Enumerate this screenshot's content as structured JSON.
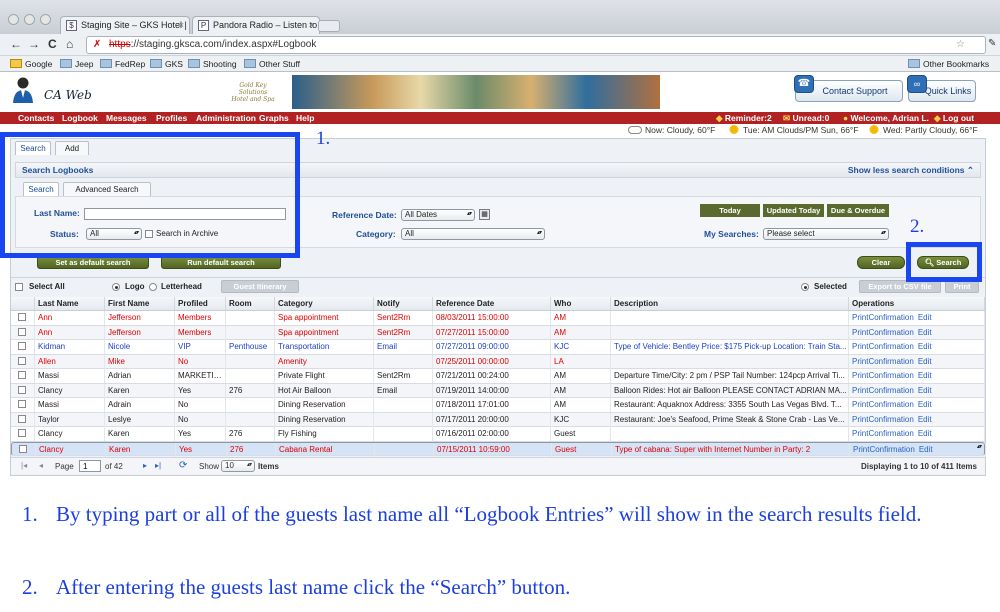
{
  "browser": {
    "tabs": [
      {
        "label": "Staging Site – GKS Hotel | Lo",
        "favicon": "GKS"
      },
      {
        "label": "Pandora Radio – Listen to Fr",
        "favicon": "P"
      }
    ],
    "url_proto": "https",
    "url_rest": "://staging.gksca.com/index.aspx#Logbook",
    "bookmarks": [
      "Google",
      "Jeep",
      "FedRep",
      "GKS",
      "Shooting",
      "Other Stuff"
    ],
    "other_bookmarks": "Other Bookmarks"
  },
  "app": {
    "logo_text": "CA Web",
    "hotel_logo": "Gold Key Solutions Hotel and Spa",
    "contact_support": "Contact Support",
    "quick_links": "Quick Links"
  },
  "menu": {
    "items": [
      "Contacts",
      "Logbook",
      "Messages",
      "Profiles",
      "Administration",
      "Graphs",
      "Help"
    ],
    "reminder": "Reminder:2",
    "unread": "Unread:0",
    "welcome": "Welcome, Adrian L.",
    "logout": "Log out"
  },
  "weather": {
    "now": "Now: Cloudy, 60°F",
    "tue": "Tue: AM Clouds/PM Sun, 66°F",
    "wed": "Wed: Partly Cloudy, 66°F"
  },
  "page_tabs": [
    "Search",
    "Add"
  ],
  "search": {
    "section_title": "Search Logbooks",
    "toggle_conditions": "Show less search conditions",
    "subtabs": [
      "Search",
      "Advanced Search"
    ],
    "last_name_label": "Last Name:",
    "last_name_value": "",
    "status_label": "Status:",
    "status_value": "All",
    "archive_label": "Search in Archive",
    "refdate_label": "Reference Date:",
    "refdate_value": "All Dates",
    "category_label": "Category:",
    "category_value": "All",
    "quick_buttons": [
      "Today",
      "Updated Today",
      "Due & Overdue"
    ],
    "my_searches_label": "My Searches:",
    "my_searches_value": "Please select",
    "set_default": "Set as default search",
    "run_default": "Run default search",
    "clear": "Clear",
    "search_button": "Search"
  },
  "grid_toolbar": {
    "select_all": "Select All",
    "logo": "Logo",
    "letterhead": "Letterhead",
    "guest_itinerary": "Guest Itinerary",
    "selected": "Selected",
    "export_csv": "Export to CSV file",
    "print": "Print"
  },
  "columns": [
    "Last Name",
    "First Name",
    "Profiled",
    "Room",
    "Category",
    "Notify",
    "Reference Date",
    "Who",
    "Description",
    "Operations"
  ],
  "rows": [
    {
      "last": "Ann",
      "first": "Jefferson",
      "profiled": "Members",
      "room": "",
      "category": "Spa appointment",
      "notify": "Sent2Rm",
      "date": "08/03/2011 15:00:00",
      "who": "AM",
      "desc": "",
      "color": "red"
    },
    {
      "last": "Ann",
      "first": "Jefferson",
      "profiled": "Members",
      "room": "",
      "category": "Spa appointment",
      "notify": "Sent2Rm",
      "date": "07/27/2011 15:00:00",
      "who": "AM",
      "desc": "",
      "color": "red"
    },
    {
      "last": "Kidman",
      "first": "Nicole",
      "profiled": "VIP",
      "room": "Penthouse",
      "category": "Transportation",
      "notify": "Email",
      "date": "07/27/2011 09:00:00",
      "who": "KJC",
      "desc": "Type of Vehicle: Bentley Price: $175 Pick-up Location: Train Sta...",
      "color": "blue"
    },
    {
      "last": "Allen",
      "first": "Mike",
      "profiled": "No",
      "room": "",
      "category": "Amenity",
      "notify": "",
      "date": "07/25/2011 00:00:00",
      "who": "LA",
      "desc": "",
      "color": "red"
    },
    {
      "last": "Massi",
      "first": "Adrian",
      "profiled": "MARKETING",
      "room": "",
      "category": "Private Flight",
      "notify": "Sent2Rm",
      "date": "07/21/2011 00:24:00",
      "who": "AM",
      "desc": "Departure Time/City: 2 pm / PSP Tail Number: 124pcp Arrival Ti...",
      "color": ""
    },
    {
      "last": "Clancy",
      "first": "Karen",
      "profiled": "Yes",
      "room": "276",
      "category": "Hot Air Balloon",
      "notify": "Email",
      "date": "07/19/2011 14:00:00",
      "who": "AM",
      "desc": "Balloon Rides: Hot air Balloon PLEASE CONTACT ADRIAN MA...",
      "color": ""
    },
    {
      "last": "Massi",
      "first": "Adrain",
      "profiled": "No",
      "room": "",
      "category": "Dining Reservation",
      "notify": "",
      "date": "07/18/2011 17:01:00",
      "who": "AM",
      "desc": "Restaurant: Aquaknox Address: 3355 South Las Vegas Blvd. T...",
      "color": ""
    },
    {
      "last": "Taylor",
      "first": "Leslye",
      "profiled": "No",
      "room": "",
      "category": "Dining Reservation",
      "notify": "",
      "date": "07/17/2011 20:00:00",
      "who": "KJC",
      "desc": "Restaurant: Joe's Seafood, Prime Steak & Stone Crab - Las Ve...",
      "color": ""
    },
    {
      "last": "Clancy",
      "first": "Karen",
      "profiled": "Yes",
      "room": "276",
      "category": "Fly Fishing",
      "notify": "",
      "date": "07/16/2011 02:00:00",
      "who": "Guest",
      "desc": "",
      "color": ""
    },
    {
      "last": "Clancy",
      "first": "Karen",
      "profiled": "Yes",
      "room": "276",
      "category": "Cabana Rental",
      "notify": "",
      "date": "07/15/2011 10:59:00",
      "who": "Guest",
      "desc": "Type of cabana: Super with Internet Number in Party: 2",
      "color": "red"
    }
  ],
  "operations": {
    "print": "PrintConfirmation",
    "edit": "Edit"
  },
  "pager": {
    "page_label": "Page",
    "page_value": "1",
    "of_pages": "of 42",
    "show_label": "Show",
    "show_value": "10",
    "items_label": "Items",
    "displaying": "Displaying 1 to 10 of 411 Items"
  },
  "annotations": {
    "marker1": "1.",
    "marker2": "2.",
    "note1_num": "1.",
    "note1_text": "By typing part or all of the guests last name all “Logbook Entries” will show in the search results field.",
    "note2_num": "2.",
    "note2_text": "After entering the guests last name click the “Search” button.",
    "highlight_color": "#1946f0"
  }
}
